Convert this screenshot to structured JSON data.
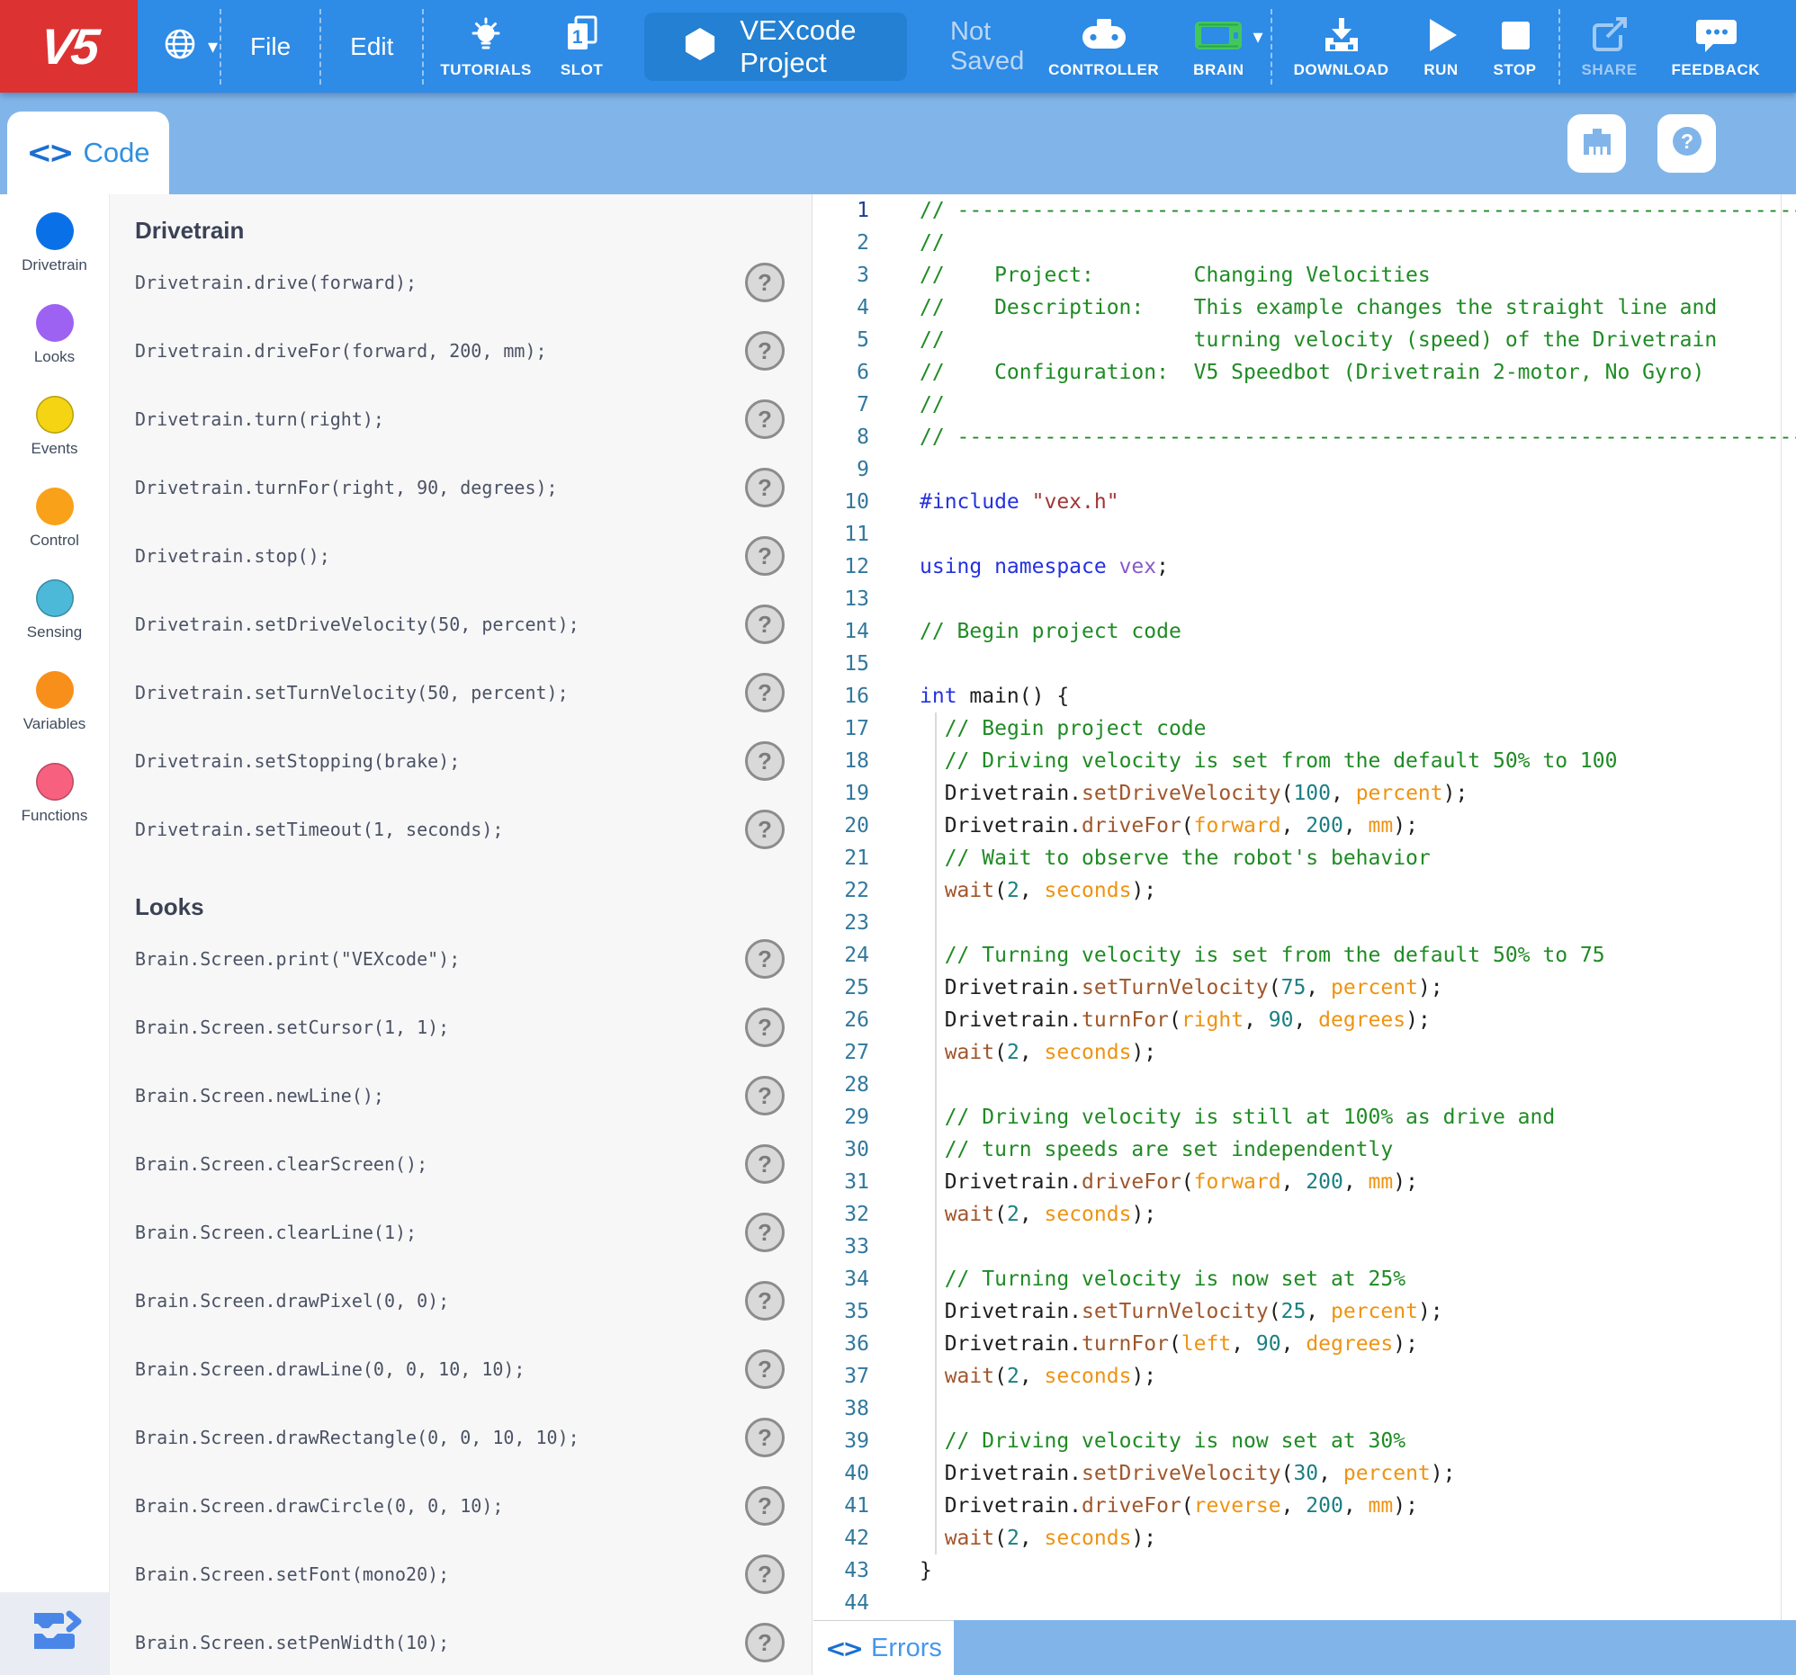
{
  "topbar": {
    "logo": "V5",
    "menus": [
      {
        "label": "File"
      },
      {
        "label": "Edit"
      }
    ],
    "tutorials_label": "TUTORIALS",
    "slot_label": "SLOT",
    "slot_number": "1",
    "project_name": "VEXcode Project",
    "save_status": "Not Saved",
    "controller_label": "CONTROLLER",
    "brain_label": "BRAIN",
    "download_label": "DOWNLOAD",
    "run_label": "RUN",
    "stop_label": "STOP",
    "share_label": "SHARE",
    "feedback_label": "FEEDBACK"
  },
  "tabbar": {
    "code_tab_label": "Code"
  },
  "icons": {
    "globe-icon": "language/globe",
    "caret-down-icon": "▾",
    "lightbulb-icon": "tutorials bulb",
    "slot-icon": "document with number 1",
    "hexagon-icon": "project hexagon",
    "controller-icon": "gamepad",
    "brain-icon": "green robot brain",
    "download-icon": "arrow into tray",
    "run-icon": "play triangle",
    "stop-icon": "square",
    "share-icon": "box with outgoing arrow",
    "feedback-icon": "speech bubble with dots",
    "device-port-icon": "brain port device",
    "help-icon": "question mark in circle",
    "code-tab-icon": "<>",
    "errors-tab-icon": "<>",
    "blocks-toggle-icon": "blocks with chevron"
  },
  "sidebar": {
    "categories": [
      {
        "label": "Drivetrain",
        "color": "#0a70e8",
        "border": false
      },
      {
        "label": "Looks",
        "color": "#9d62f2",
        "border": false
      },
      {
        "label": "Events",
        "color": "#f5d413",
        "border": true
      },
      {
        "label": "Control",
        "color": "#f9a119",
        "border": false
      },
      {
        "label": "Sensing",
        "color": "#4cb9d8",
        "border": true
      },
      {
        "label": "Variables",
        "color": "#f98f1b",
        "border": false
      },
      {
        "label": "Functions",
        "color": "#f7617f",
        "border": true
      }
    ]
  },
  "command_panel": {
    "help_glyph": "?",
    "sections": [
      {
        "title": "Drivetrain",
        "commands": [
          "Drivetrain.drive(forward);",
          "Drivetrain.driveFor(forward, 200, mm);",
          "Drivetrain.turn(right);",
          "Drivetrain.turnFor(right, 90, degrees);",
          "Drivetrain.stop();",
          "Drivetrain.setDriveVelocity(50, percent);",
          "Drivetrain.setTurnVelocity(50, percent);",
          "Drivetrain.setStopping(brake);",
          "Drivetrain.setTimeout(1, seconds);"
        ]
      },
      {
        "title": "Looks",
        "commands": [
          "Brain.Screen.print(\"VEXcode\");",
          "Brain.Screen.setCursor(1, 1);",
          "Brain.Screen.newLine();",
          "Brain.Screen.clearScreen();",
          "Brain.Screen.clearLine(1);",
          "Brain.Screen.drawPixel(0, 0);",
          "Brain.Screen.drawLine(0, 0, 10, 10);",
          "Brain.Screen.drawRectangle(0, 0, 10, 10);",
          "Brain.Screen.drawCircle(0, 0, 10);",
          "Brain.Screen.setFont(mono20);",
          "Brain.Screen.setPenWidth(10);"
        ]
      }
    ]
  },
  "editor": {
    "lines": [
      {
        "n": 1,
        "cur": true,
        "t": [
          [
            "cm",
            "// ------------------------------------------------------------------------------------------"
          ]
        ]
      },
      {
        "n": 2,
        "t": [
          [
            "cm",
            "//"
          ]
        ]
      },
      {
        "n": 3,
        "t": [
          [
            "cm",
            "//    Project:        Changing Velocities"
          ]
        ]
      },
      {
        "n": 4,
        "t": [
          [
            "cm",
            "//    Description:    This example changes the straight line and"
          ]
        ]
      },
      {
        "n": 5,
        "t": [
          [
            "cm",
            "//                    turning velocity (speed) of the Drivetrain"
          ]
        ]
      },
      {
        "n": 6,
        "t": [
          [
            "cm",
            "//    Configuration:  V5 Speedbot (Drivetrain 2-motor, No Gyro)"
          ]
        ]
      },
      {
        "n": 7,
        "t": [
          [
            "cm",
            "//"
          ]
        ]
      },
      {
        "n": 8,
        "t": [
          [
            "cm",
            "// ------------------------------------------------------------------------------------------"
          ]
        ]
      },
      {
        "n": 9,
        "t": []
      },
      {
        "n": 10,
        "t": [
          [
            "kw",
            "#include"
          ],
          [
            "pl",
            " "
          ],
          [
            "str",
            "\"vex.h\""
          ]
        ]
      },
      {
        "n": 11,
        "t": []
      },
      {
        "n": 12,
        "t": [
          [
            "kw",
            "using namespace"
          ],
          [
            "pl",
            " "
          ],
          [
            "ns",
            "vex"
          ],
          [
            "pl",
            ";"
          ]
        ]
      },
      {
        "n": 13,
        "t": []
      },
      {
        "n": 14,
        "t": [
          [
            "cm",
            "// Begin project code"
          ]
        ]
      },
      {
        "n": 15,
        "t": []
      },
      {
        "n": 16,
        "t": [
          [
            "kw",
            "int"
          ],
          [
            "pl",
            " main() {"
          ]
        ]
      },
      {
        "n": 17,
        "g": true,
        "t": [
          [
            "pl",
            "  "
          ],
          [
            "cm",
            "// Begin project code"
          ]
        ]
      },
      {
        "n": 18,
        "g": true,
        "t": [
          [
            "pl",
            "  "
          ],
          [
            "cm",
            "// Driving velocity is set from the default 50% to 100"
          ]
        ]
      },
      {
        "n": 19,
        "g": true,
        "t": [
          [
            "pl",
            "  Drivetrain."
          ],
          [
            "fn",
            "setDriveVelocity"
          ],
          [
            "pl",
            "("
          ],
          [
            "num",
            "100"
          ],
          [
            "pl",
            ", "
          ],
          [
            "pa",
            "percent"
          ],
          [
            "pl",
            ");"
          ]
        ]
      },
      {
        "n": 20,
        "g": true,
        "t": [
          [
            "pl",
            "  Drivetrain."
          ],
          [
            "fn",
            "driveFor"
          ],
          [
            "pl",
            "("
          ],
          [
            "pa",
            "forward"
          ],
          [
            "pl",
            ", "
          ],
          [
            "num",
            "200"
          ],
          [
            "pl",
            ", "
          ],
          [
            "pa",
            "mm"
          ],
          [
            "pl",
            ");"
          ]
        ]
      },
      {
        "n": 21,
        "g": true,
        "t": [
          [
            "pl",
            "  "
          ],
          [
            "cm",
            "// Wait to observe the robot's behavior"
          ]
        ]
      },
      {
        "n": 22,
        "g": true,
        "t": [
          [
            "pl",
            "  "
          ],
          [
            "fn",
            "wait"
          ],
          [
            "pl",
            "("
          ],
          [
            "num",
            "2"
          ],
          [
            "pl",
            ", "
          ],
          [
            "pa",
            "seconds"
          ],
          [
            "pl",
            ");"
          ]
        ]
      },
      {
        "n": 23,
        "g": true,
        "t": []
      },
      {
        "n": 24,
        "g": true,
        "t": [
          [
            "pl",
            "  "
          ],
          [
            "cm",
            "// Turning velocity is set from the default 50% to 75"
          ]
        ]
      },
      {
        "n": 25,
        "g": true,
        "t": [
          [
            "pl",
            "  Drivetrain."
          ],
          [
            "fn",
            "setTurnVelocity"
          ],
          [
            "pl",
            "("
          ],
          [
            "num",
            "75"
          ],
          [
            "pl",
            ", "
          ],
          [
            "pa",
            "percent"
          ],
          [
            "pl",
            ");"
          ]
        ]
      },
      {
        "n": 26,
        "g": true,
        "t": [
          [
            "pl",
            "  Drivetrain."
          ],
          [
            "fn",
            "turnFor"
          ],
          [
            "pl",
            "("
          ],
          [
            "pa",
            "right"
          ],
          [
            "pl",
            ", "
          ],
          [
            "num",
            "90"
          ],
          [
            "pl",
            ", "
          ],
          [
            "pa",
            "degrees"
          ],
          [
            "pl",
            ");"
          ]
        ]
      },
      {
        "n": 27,
        "g": true,
        "t": [
          [
            "pl",
            "  "
          ],
          [
            "fn",
            "wait"
          ],
          [
            "pl",
            "("
          ],
          [
            "num",
            "2"
          ],
          [
            "pl",
            ", "
          ],
          [
            "pa",
            "seconds"
          ],
          [
            "pl",
            ");"
          ]
        ]
      },
      {
        "n": 28,
        "g": true,
        "t": []
      },
      {
        "n": 29,
        "g": true,
        "t": [
          [
            "pl",
            "  "
          ],
          [
            "cm",
            "// Driving velocity is still at 100% as drive and"
          ]
        ]
      },
      {
        "n": 30,
        "g": true,
        "t": [
          [
            "pl",
            "  "
          ],
          [
            "cm",
            "// turn speeds are set independently"
          ]
        ]
      },
      {
        "n": 31,
        "g": true,
        "t": [
          [
            "pl",
            "  Drivetrain."
          ],
          [
            "fn",
            "driveFor"
          ],
          [
            "pl",
            "("
          ],
          [
            "pa",
            "forward"
          ],
          [
            "pl",
            ", "
          ],
          [
            "num",
            "200"
          ],
          [
            "pl",
            ", "
          ],
          [
            "pa",
            "mm"
          ],
          [
            "pl",
            ");"
          ]
        ]
      },
      {
        "n": 32,
        "g": true,
        "t": [
          [
            "pl",
            "  "
          ],
          [
            "fn",
            "wait"
          ],
          [
            "pl",
            "("
          ],
          [
            "num",
            "2"
          ],
          [
            "pl",
            ", "
          ],
          [
            "pa",
            "seconds"
          ],
          [
            "pl",
            ");"
          ]
        ]
      },
      {
        "n": 33,
        "g": true,
        "t": []
      },
      {
        "n": 34,
        "g": true,
        "t": [
          [
            "pl",
            "  "
          ],
          [
            "cm",
            "// Turning velocity is now set at 25%"
          ]
        ]
      },
      {
        "n": 35,
        "g": true,
        "t": [
          [
            "pl",
            "  Drivetrain."
          ],
          [
            "fn",
            "setTurnVelocity"
          ],
          [
            "pl",
            "("
          ],
          [
            "num",
            "25"
          ],
          [
            "pl",
            ", "
          ],
          [
            "pa",
            "percent"
          ],
          [
            "pl",
            ");"
          ]
        ]
      },
      {
        "n": 36,
        "g": true,
        "t": [
          [
            "pl",
            "  Drivetrain."
          ],
          [
            "fn",
            "turnFor"
          ],
          [
            "pl",
            "("
          ],
          [
            "pa",
            "left"
          ],
          [
            "pl",
            ", "
          ],
          [
            "num",
            "90"
          ],
          [
            "pl",
            ", "
          ],
          [
            "pa",
            "degrees"
          ],
          [
            "pl",
            ");"
          ]
        ]
      },
      {
        "n": 37,
        "g": true,
        "t": [
          [
            "pl",
            "  "
          ],
          [
            "fn",
            "wait"
          ],
          [
            "pl",
            "("
          ],
          [
            "num",
            "2"
          ],
          [
            "pl",
            ", "
          ],
          [
            "pa",
            "seconds"
          ],
          [
            "pl",
            ");"
          ]
        ]
      },
      {
        "n": 38,
        "g": true,
        "t": []
      },
      {
        "n": 39,
        "g": true,
        "t": [
          [
            "pl",
            "  "
          ],
          [
            "cm",
            "// Driving velocity is now set at 30%"
          ]
        ]
      },
      {
        "n": 40,
        "g": true,
        "t": [
          [
            "pl",
            "  Drivetrain."
          ],
          [
            "fn",
            "setDriveVelocity"
          ],
          [
            "pl",
            "("
          ],
          [
            "num",
            "30"
          ],
          [
            "pl",
            ", "
          ],
          [
            "pa",
            "percent"
          ],
          [
            "pl",
            ");"
          ]
        ]
      },
      {
        "n": 41,
        "g": true,
        "t": [
          [
            "pl",
            "  Drivetrain."
          ],
          [
            "fn",
            "driveFor"
          ],
          [
            "pl",
            "("
          ],
          [
            "pa",
            "reverse"
          ],
          [
            "pl",
            ", "
          ],
          [
            "num",
            "200"
          ],
          [
            "pl",
            ", "
          ],
          [
            "pa",
            "mm"
          ],
          [
            "pl",
            ");"
          ]
        ]
      },
      {
        "n": 42,
        "g": true,
        "t": [
          [
            "pl",
            "  "
          ],
          [
            "fn",
            "wait"
          ],
          [
            "pl",
            "("
          ],
          [
            "num",
            "2"
          ],
          [
            "pl",
            ", "
          ],
          [
            "pa",
            "seconds"
          ],
          [
            "pl",
            ");"
          ]
        ]
      },
      {
        "n": 43,
        "t": [
          [
            "pl",
            "}"
          ]
        ]
      },
      {
        "n": 44,
        "t": []
      }
    ]
  },
  "errors_bar": {
    "label": "Errors"
  }
}
